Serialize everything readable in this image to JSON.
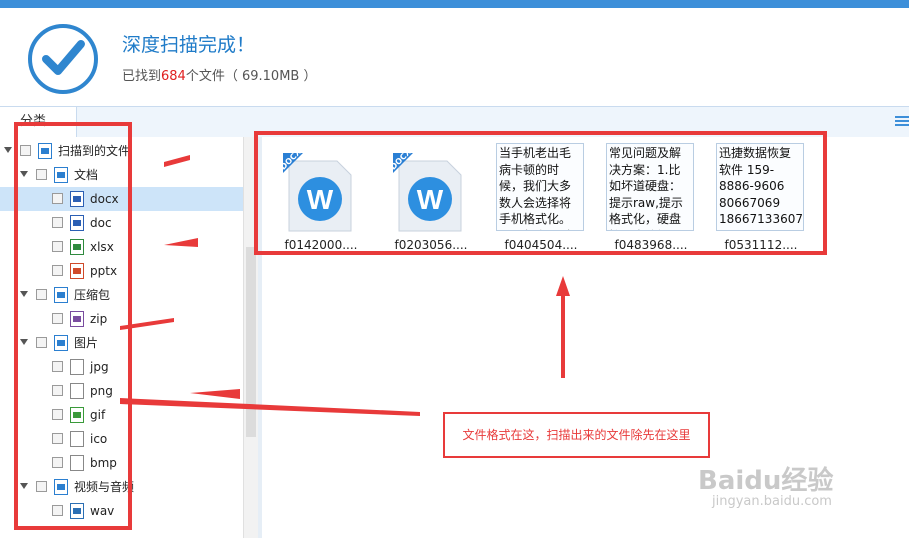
{
  "header": {
    "title": "深度扫描完成！",
    "subtitle_prefix": "已找到",
    "count": "684",
    "subtitle_suffix": "个文件（ 69.10MB ）"
  },
  "tabs": {
    "category": "分类"
  },
  "tree": [
    {
      "label": "扫描到的文件",
      "level": 0,
      "icon": "list-icon"
    },
    {
      "label": "文档",
      "level": 1,
      "icon": "document-icon"
    },
    {
      "label": "docx",
      "level": 2,
      "icon": "word-icon",
      "selected": true
    },
    {
      "label": "doc",
      "level": 2,
      "icon": "word-icon"
    },
    {
      "label": "xlsx",
      "level": 2,
      "icon": "excel-icon"
    },
    {
      "label": "pptx",
      "level": 2,
      "icon": "powerpoint-icon"
    },
    {
      "label": "压缩包",
      "level": 1,
      "icon": "archive-icon"
    },
    {
      "label": "zip",
      "level": 2,
      "icon": "zip-icon"
    },
    {
      "label": "图片",
      "level": 1,
      "icon": "image-icon"
    },
    {
      "label": "jpg",
      "level": 2,
      "icon": "file-icon"
    },
    {
      "label": "png",
      "level": 2,
      "icon": "file-icon"
    },
    {
      "label": "gif",
      "level": 2,
      "icon": "gif-icon"
    },
    {
      "label": "ico",
      "level": 2,
      "icon": "file-icon"
    },
    {
      "label": "bmp",
      "level": 2,
      "icon": "file-icon"
    },
    {
      "label": "视频与音频",
      "level": 1,
      "icon": "video-icon"
    },
    {
      "label": "wav",
      "level": 2,
      "icon": "audio-icon"
    }
  ],
  "files": [
    {
      "name": "f0142000....",
      "kind": "docx",
      "badge": "DOCX"
    },
    {
      "name": "f0203056....",
      "kind": "docx",
      "badge": "DOCX"
    },
    {
      "name": "f0404504....",
      "kind": "text",
      "preview": "当手机老出毛病卡顿的时候，我们大多数人会选择将手机格式化。可是却忘了对手机中的联系"
    },
    {
      "name": "f0483968....",
      "kind": "text",
      "preview": "常见问题及解决方案：1.比如坏道硬盘：提示raw,提示格式化，硬盘接到电脑提上"
    },
    {
      "name": "f0531112....",
      "kind": "text",
      "preview": "迅捷数据恢复软件 159-8886-9606 80667069 18667133607"
    }
  ],
  "annotation": "文件格式在这，扫描出来的文件除先在这里",
  "watermark": {
    "brand": "Baidu经验",
    "url": "jingyan.baidu.com"
  },
  "colors": {
    "accent": "#3d8fd9",
    "annotation_red": "#e83a3a",
    "count_red": "#e02020"
  }
}
